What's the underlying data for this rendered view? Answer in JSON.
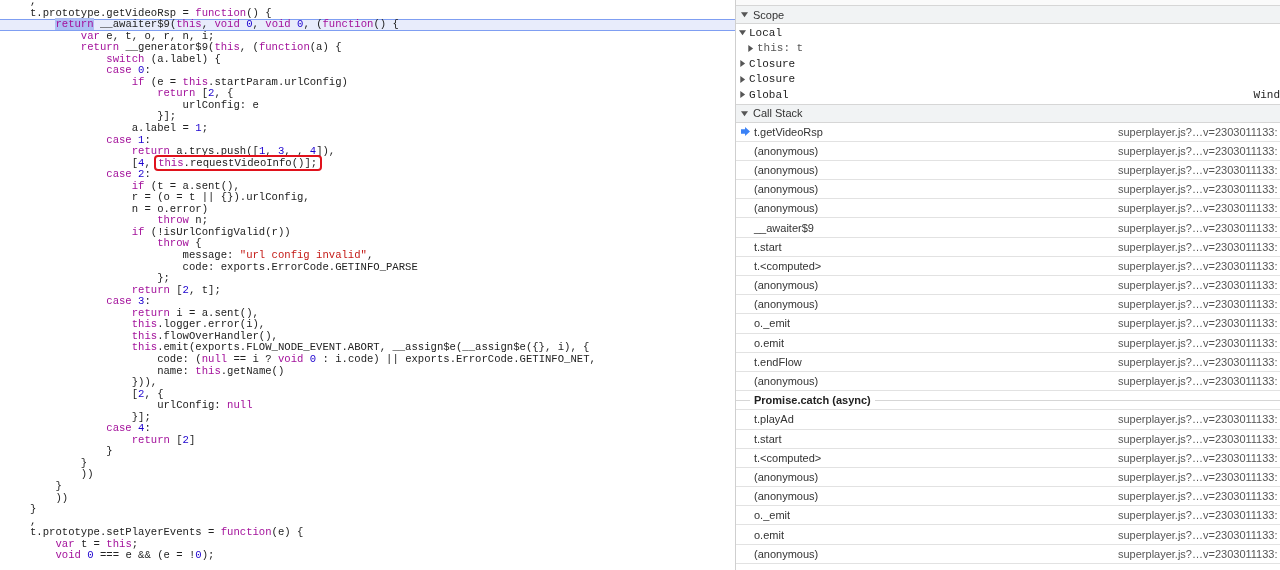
{
  "code_lines": [
    {
      "current": false,
      "tokens": [
        {
          "kind": "p",
          "text": ","
        }
      ]
    },
    {
      "current": false,
      "tokens": [
        {
          "kind": "p",
          "text": "t.prototype.getVideoRsp = "
        },
        {
          "kind": "kw",
          "text": "function"
        },
        {
          "kind": "p",
          "text": "() {"
        }
      ]
    },
    {
      "current": true,
      "tokens": [
        {
          "kind": "sel",
          "text": "    return"
        },
        {
          "kind": "p",
          "text": " __awaiter$9("
        },
        {
          "kind": "kw",
          "text": "this"
        },
        {
          "kind": "p",
          "text": ", "
        },
        {
          "kind": "kw",
          "text": "void"
        },
        {
          "kind": "num",
          "text": " 0"
        },
        {
          "kind": "p",
          "text": ", "
        },
        {
          "kind": "kw",
          "text": "void"
        },
        {
          "kind": "num",
          "text": " 0"
        },
        {
          "kind": "p",
          "text": ", ("
        },
        {
          "kind": "kw",
          "text": "function"
        },
        {
          "kind": "p",
          "text": "() {"
        }
      ]
    },
    {
      "current": false,
      "tokens": [
        {
          "kind": "kw",
          "text": "        var"
        },
        {
          "kind": "p",
          "text": " e, t, o, r, n, i;"
        }
      ]
    },
    {
      "current": false,
      "tokens": [
        {
          "kind": "kw",
          "text": "        return"
        },
        {
          "kind": "p",
          "text": " __generator$9("
        },
        {
          "kind": "kw",
          "text": "this"
        },
        {
          "kind": "p",
          "text": ", ("
        },
        {
          "kind": "kw",
          "text": "function"
        },
        {
          "kind": "p",
          "text": "(a) {"
        }
      ]
    },
    {
      "current": false,
      "tokens": [
        {
          "kind": "kw",
          "text": "            switch"
        },
        {
          "kind": "p",
          "text": " (a.label) {"
        }
      ]
    },
    {
      "current": false,
      "tokens": [
        {
          "kind": "kw",
          "text": "            case"
        },
        {
          "kind": "num",
          "text": " 0"
        },
        {
          "kind": "p",
          "text": ":"
        }
      ]
    },
    {
      "current": false,
      "tokens": [
        {
          "kind": "kw",
          "text": "                if"
        },
        {
          "kind": "p",
          "text": " (e = "
        },
        {
          "kind": "kw",
          "text": "this"
        },
        {
          "kind": "p",
          "text": ".startParam.urlConfig)"
        }
      ]
    },
    {
      "current": false,
      "tokens": [
        {
          "kind": "kw",
          "text": "                    return"
        },
        {
          "kind": "p",
          "text": " ["
        },
        {
          "kind": "num",
          "text": "2"
        },
        {
          "kind": "p",
          "text": ", {"
        }
      ]
    },
    {
      "current": false,
      "tokens": [
        {
          "kind": "p",
          "text": "                        urlConfig: e"
        }
      ]
    },
    {
      "current": false,
      "tokens": [
        {
          "kind": "p",
          "text": "                    }];"
        }
      ]
    },
    {
      "current": false,
      "tokens": [
        {
          "kind": "p",
          "text": "                a.label = "
        },
        {
          "kind": "num",
          "text": "1"
        },
        {
          "kind": "p",
          "text": ";"
        }
      ]
    },
    {
      "current": false,
      "tokens": [
        {
          "kind": "kw",
          "text": "            case"
        },
        {
          "kind": "num",
          "text": " 1"
        },
        {
          "kind": "p",
          "text": ":"
        }
      ]
    },
    {
      "current": false,
      "tokens": [
        {
          "kind": "kw",
          "text": "                return"
        },
        {
          "kind": "p",
          "text": " a.trys.push(["
        },
        {
          "kind": "num",
          "text": "1"
        },
        {
          "kind": "p",
          "text": ", "
        },
        {
          "kind": "num",
          "text": "3"
        },
        {
          "kind": "p",
          "text": ", , "
        },
        {
          "kind": "num",
          "text": "4"
        },
        {
          "kind": "p",
          "text": "]),"
        }
      ]
    },
    {
      "current": false,
      "tokens": [
        {
          "kind": "p",
          "text": "                ["
        },
        {
          "kind": "num",
          "text": "4"
        },
        {
          "kind": "p",
          "text": ", "
        },
        {
          "kind": "note",
          "tokens": [
            {
              "kind": "kw",
              "text": "this"
            },
            {
              "kind": "p",
              "text": ".requestVideoInfo()];"
            }
          ]
        }
      ]
    },
    {
      "current": false,
      "tokens": [
        {
          "kind": "kw",
          "text": "            case"
        },
        {
          "kind": "num",
          "text": " 2"
        },
        {
          "kind": "p",
          "text": ":"
        }
      ]
    },
    {
      "current": false,
      "tokens": [
        {
          "kind": "kw",
          "text": "                if"
        },
        {
          "kind": "p",
          "text": " (t = a.sent(),"
        }
      ]
    },
    {
      "current": false,
      "tokens": [
        {
          "kind": "p",
          "text": "                r = (o = t || {}).urlConfig,"
        }
      ]
    },
    {
      "current": false,
      "tokens": [
        {
          "kind": "p",
          "text": "                n = o.error)"
        }
      ]
    },
    {
      "current": false,
      "tokens": [
        {
          "kind": "kw",
          "text": "                    throw"
        },
        {
          "kind": "p",
          "text": " n;"
        }
      ]
    },
    {
      "current": false,
      "tokens": [
        {
          "kind": "kw",
          "text": "                if"
        },
        {
          "kind": "p",
          "text": " (!isUrlConfigValid(r))"
        }
      ]
    },
    {
      "current": false,
      "tokens": [
        {
          "kind": "kw",
          "text": "                    throw"
        },
        {
          "kind": "p",
          "text": " {"
        }
      ]
    },
    {
      "current": false,
      "tokens": [
        {
          "kind": "p",
          "text": "                        message: "
        },
        {
          "kind": "str",
          "text": "\"url config invalid\""
        },
        {
          "kind": "p",
          "text": ","
        }
      ]
    },
    {
      "current": false,
      "tokens": [
        {
          "kind": "p",
          "text": "                        code: exports.ErrorCode.GETINFO_PARSE"
        }
      ]
    },
    {
      "current": false,
      "tokens": [
        {
          "kind": "p",
          "text": "                    };"
        }
      ]
    },
    {
      "current": false,
      "tokens": [
        {
          "kind": "kw",
          "text": "                return"
        },
        {
          "kind": "p",
          "text": " ["
        },
        {
          "kind": "num",
          "text": "2"
        },
        {
          "kind": "p",
          "text": ", t];"
        }
      ]
    },
    {
      "current": false,
      "tokens": [
        {
          "kind": "kw",
          "text": "            case"
        },
        {
          "kind": "num",
          "text": " 3"
        },
        {
          "kind": "p",
          "text": ":"
        }
      ]
    },
    {
      "current": false,
      "tokens": [
        {
          "kind": "kw",
          "text": "                return"
        },
        {
          "kind": "p",
          "text": " i = a.sent(),"
        }
      ]
    },
    {
      "current": false,
      "tokens": [
        {
          "kind": "kw",
          "text": "                this"
        },
        {
          "kind": "p",
          "text": ".logger.error(i),"
        }
      ]
    },
    {
      "current": false,
      "tokens": [
        {
          "kind": "kw",
          "text": "                this"
        },
        {
          "kind": "p",
          "text": ".flowOverHandler(),"
        }
      ]
    },
    {
      "current": false,
      "tokens": [
        {
          "kind": "kw",
          "text": "                this"
        },
        {
          "kind": "p",
          "text": ".emit(exports.FLOW_NODE_EVENT.ABORT, __assign$e(__assign$e({}, i), {"
        }
      ]
    },
    {
      "current": false,
      "tokens": [
        {
          "kind": "p",
          "text": "                    code: ("
        },
        {
          "kind": "kw",
          "text": "null"
        },
        {
          "kind": "p",
          "text": " == i ? "
        },
        {
          "kind": "kw",
          "text": "void"
        },
        {
          "kind": "num",
          "text": " 0"
        },
        {
          "kind": "p",
          "text": " : i.code) || exports.ErrorCode.GETINFO_NET,"
        }
      ]
    },
    {
      "current": false,
      "tokens": [
        {
          "kind": "p",
          "text": "                    name: "
        },
        {
          "kind": "kw",
          "text": "this"
        },
        {
          "kind": "p",
          "text": ".getName()"
        }
      ]
    },
    {
      "current": false,
      "tokens": [
        {
          "kind": "p",
          "text": "                })),"
        }
      ]
    },
    {
      "current": false,
      "tokens": [
        {
          "kind": "p",
          "text": "                ["
        },
        {
          "kind": "num",
          "text": "2"
        },
        {
          "kind": "p",
          "text": ", {"
        }
      ]
    },
    {
      "current": false,
      "tokens": [
        {
          "kind": "p",
          "text": "                    urlConfig: "
        },
        {
          "kind": "kw",
          "text": "null"
        }
      ]
    },
    {
      "current": false,
      "tokens": [
        {
          "kind": "p",
          "text": "                }];"
        }
      ]
    },
    {
      "current": false,
      "tokens": [
        {
          "kind": "kw",
          "text": "            case"
        },
        {
          "kind": "num",
          "text": " 4"
        },
        {
          "kind": "p",
          "text": ":"
        }
      ]
    },
    {
      "current": false,
      "tokens": [
        {
          "kind": "kw",
          "text": "                return"
        },
        {
          "kind": "p",
          "text": " ["
        },
        {
          "kind": "num",
          "text": "2"
        },
        {
          "kind": "p",
          "text": "]"
        }
      ]
    },
    {
      "current": false,
      "tokens": [
        {
          "kind": "p",
          "text": "            }"
        }
      ]
    },
    {
      "current": false,
      "tokens": [
        {
          "kind": "p",
          "text": "        }"
        }
      ]
    },
    {
      "current": false,
      "tokens": [
        {
          "kind": "p",
          "text": "        ))"
        }
      ]
    },
    {
      "current": false,
      "tokens": [
        {
          "kind": "p",
          "text": "    }"
        }
      ]
    },
    {
      "current": false,
      "tokens": [
        {
          "kind": "p",
          "text": "    ))"
        }
      ]
    },
    {
      "current": false,
      "tokens": [
        {
          "kind": "p",
          "text": "}"
        }
      ]
    },
    {
      "current": false,
      "tokens": [
        {
          "kind": "p",
          "text": ","
        }
      ]
    },
    {
      "current": false,
      "tokens": [
        {
          "kind": "p",
          "text": "t.prototype.setPlayerEvents = "
        },
        {
          "kind": "kw",
          "text": "function"
        },
        {
          "kind": "p",
          "text": "(e) {"
        }
      ]
    },
    {
      "current": false,
      "tokens": [
        {
          "kind": "kw",
          "text": "    var"
        },
        {
          "kind": "p",
          "text": " t = "
        },
        {
          "kind": "kw",
          "text": "this"
        },
        {
          "kind": "p",
          "text": ";"
        }
      ]
    },
    {
      "current": false,
      "tokens": [
        {
          "kind": "kw",
          "text": "    void"
        },
        {
          "kind": "num",
          "text": " 0"
        },
        {
          "kind": "p",
          "text": " === e && (e = !"
        },
        {
          "kind": "num",
          "text": "0"
        },
        {
          "kind": "p",
          "text": ");"
        }
      ]
    }
  ],
  "scope": {
    "title": "Scope",
    "expanded": true,
    "items": [
      {
        "label": "Local",
        "expanded": true,
        "children": [
          {
            "label": "this: t",
            "expanded": false
          }
        ]
      },
      {
        "label": "Closure",
        "expanded": false
      },
      {
        "label": "Closure",
        "expanded": false
      },
      {
        "label": "Global",
        "expanded": false,
        "value": "Wind"
      }
    ]
  },
  "call_stack": {
    "title": "Call Stack",
    "expanded": true,
    "frames": [
      {
        "kind": "frame",
        "name": "t.getVideoRsp",
        "location": "superplayer.js?…v=2303011133:",
        "current": true
      },
      {
        "kind": "frame",
        "name": "(anonymous)",
        "location": "superplayer.js?…v=2303011133:",
        "current": false
      },
      {
        "kind": "frame",
        "name": "(anonymous)",
        "location": "superplayer.js?…v=2303011133:",
        "current": false
      },
      {
        "kind": "frame",
        "name": "(anonymous)",
        "location": "superplayer.js?…v=2303011133:",
        "current": false
      },
      {
        "kind": "frame",
        "name": "(anonymous)",
        "location": "superplayer.js?…v=2303011133:",
        "current": false
      },
      {
        "kind": "frame",
        "name": "__awaiter$9",
        "location": "superplayer.js?…v=2303011133:",
        "current": false
      },
      {
        "kind": "frame",
        "name": "t.start",
        "location": "superplayer.js?…v=2303011133:",
        "current": false
      },
      {
        "kind": "frame",
        "name": "t.<computed>",
        "location": "superplayer.js?…v=2303011133:",
        "current": false
      },
      {
        "kind": "frame",
        "name": "(anonymous)",
        "location": "superplayer.js?…v=2303011133:",
        "current": false
      },
      {
        "kind": "frame",
        "name": "(anonymous)",
        "location": "superplayer.js?…v=2303011133:",
        "current": false
      },
      {
        "kind": "frame",
        "name": "o._emit",
        "location": "superplayer.js?…v=2303011133:",
        "current": false
      },
      {
        "kind": "frame",
        "name": "o.emit",
        "location": "superplayer.js?…v=2303011133:",
        "current": false
      },
      {
        "kind": "frame",
        "name": "t.endFlow",
        "location": "superplayer.js?…v=2303011133:",
        "current": false
      },
      {
        "kind": "frame",
        "name": "(anonymous)",
        "location": "superplayer.js?…v=2303011133:",
        "current": false
      },
      {
        "kind": "async",
        "name": "Promise.catch (async)"
      },
      {
        "kind": "frame",
        "name": "t.playAd",
        "location": "superplayer.js?…v=2303011133:",
        "current": false
      },
      {
        "kind": "frame",
        "name": "t.start",
        "location": "superplayer.js?…v=2303011133:",
        "current": false
      },
      {
        "kind": "frame",
        "name": "t.<computed>",
        "location": "superplayer.js?…v=2303011133:",
        "current": false
      },
      {
        "kind": "frame",
        "name": "(anonymous)",
        "location": "superplayer.js?…v=2303011133:",
        "current": false
      },
      {
        "kind": "frame",
        "name": "(anonymous)",
        "location": "superplayer.js?…v=2303011133:",
        "current": false
      },
      {
        "kind": "frame",
        "name": "o._emit",
        "location": "superplayer.js?…v=2303011133:",
        "current": false
      },
      {
        "kind": "frame",
        "name": "o.emit",
        "location": "superplayer.js?…v=2303011133:",
        "current": false
      },
      {
        "kind": "frame",
        "name": "(anonymous)",
        "location": "superplayer.js?…v=2303011133:",
        "current": false
      }
    ]
  }
}
